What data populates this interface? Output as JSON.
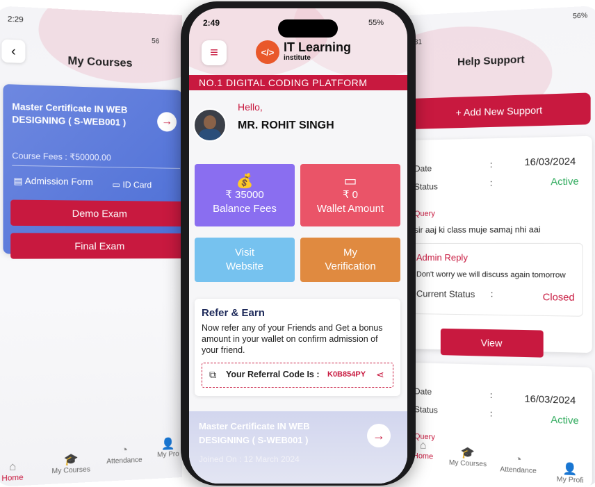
{
  "left": {
    "time": "2:29",
    "signal": "56",
    "title": "My Courses",
    "course": {
      "name": "Master Certificate IN WEB DESIGNING ( S-WEB001 )",
      "fees": "Course Fees : ₹50000.00",
      "admission": "Admission Form",
      "idcard": "ID Card",
      "demo": "Demo Exam",
      "final": "Final Exam"
    },
    "nav": [
      "Home",
      "My Courses",
      "Attendance",
      "My Pro"
    ]
  },
  "main": {
    "time": "2:49",
    "battery": "55%",
    "logo_title": "IT Learning",
    "logo_sub": "institute",
    "banner": "NO.1 DIGITAL CODING PLATFORM",
    "hello": "Hello,",
    "user": "MR. ROHIT SINGH",
    "balance_value": "₹ 35000",
    "balance_label": "Balance Fees",
    "wallet_value": "₹ 0",
    "wallet_label": "Wallet Amount",
    "visit_line1": "Visit",
    "visit_line2": "Website",
    "verify_line1": "My",
    "verify_line2": "Verification",
    "refer_title": "Refer & Earn",
    "refer_text": "Now refer any of your Friends and Get a bonus amount in your wallet on confirm admission of your friend.",
    "referral_label": "Your Referral Code Is :",
    "referral_code": "K0B854PY",
    "course_name": "Master Certificate IN WEB DESIGNING ( S-WEB001 )",
    "joined": "Joined On : 12 March 2024"
  },
  "right": {
    "time": "31",
    "battery": "56%",
    "title": "Help Support",
    "add": "+ Add New Support",
    "t1": {
      "date_label": "Date",
      "date": "16/03/2024",
      "status_label": "Status",
      "status": "Active",
      "query_label": "Query",
      "query": "sir aaj ki class muje samaj nhi aai",
      "reply_label": "Admin Reply",
      "reply": "Don't worry we will discuss again tomorrow",
      "cs_label": "Current Status",
      "cs": "Closed",
      "view": "View"
    },
    "t2": {
      "date_label": "Date",
      "date": "16/03/2024",
      "status_label": "Status",
      "status": "Active",
      "query_label": "Query"
    },
    "colon": ":",
    "nav": [
      "Home",
      "My Courses",
      "Attendance",
      "My Profi"
    ]
  },
  "colors": {
    "primary": "#c8193f",
    "purple": "#8a6ef0",
    "pink": "#ea5468",
    "sky": "#76c2ef",
    "orange": "#e08a40",
    "green": "#2eaa5c"
  }
}
